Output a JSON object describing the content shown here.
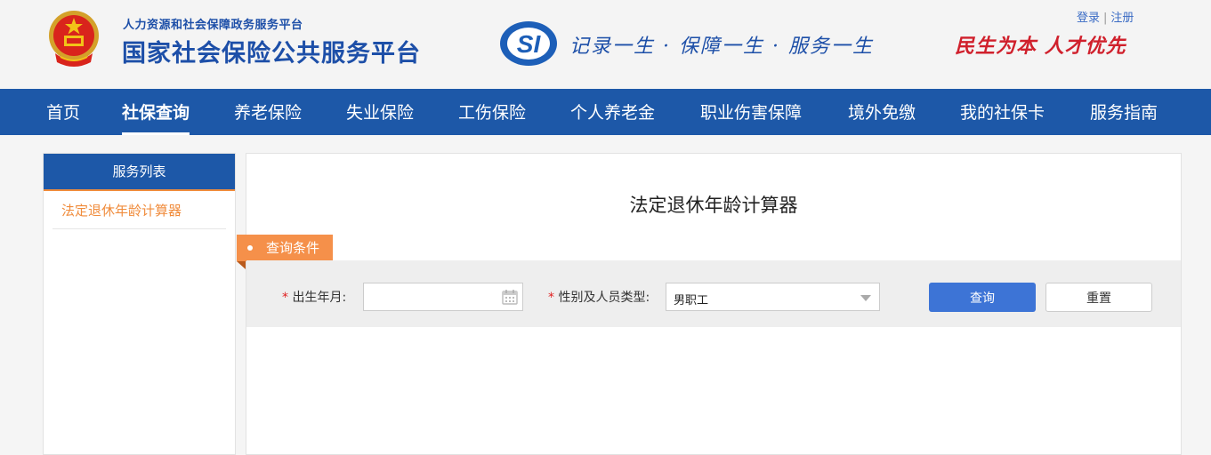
{
  "header": {
    "subtitle": "人力资源和社会保障政务服务平台",
    "title": "国家社会保险公共服务平台",
    "logo_text": "SI",
    "slogan": "记录一生 · 保障一生 · 服务一生",
    "motto": "民生为本 人才优先",
    "login": "登录",
    "separator": "|",
    "register": "注册"
  },
  "nav": {
    "items": [
      {
        "label": "首页"
      },
      {
        "label": "社保查询",
        "active": true
      },
      {
        "label": "养老保险"
      },
      {
        "label": "失业保险"
      },
      {
        "label": "工伤保险"
      },
      {
        "label": "个人养老金"
      },
      {
        "label": "职业伤害保障"
      },
      {
        "label": "境外免缴"
      },
      {
        "label": "我的社保卡"
      },
      {
        "label": "服务指南"
      }
    ]
  },
  "sidebar": {
    "heading": "服务列表",
    "items": [
      {
        "label": "法定退休年龄计算器"
      }
    ]
  },
  "main": {
    "title": "法定退休年龄计算器",
    "condition_tag": "查询条件",
    "required_mark": "*",
    "birth_label": "出生年月:",
    "birth_value": "",
    "gender_label": "性别及人员类型:",
    "gender_value": "男职工",
    "query_button": "查询",
    "reset_button": "重置"
  },
  "colors": {
    "brand_blue": "#1d58a8",
    "accent_orange": "#f08c3c",
    "motto_red": "#d0202c",
    "query_button": "#3d74d6"
  },
  "icons": [
    "national-emblem-icon",
    "si-logo-icon",
    "calendar-icon",
    "chevron-down-icon"
  ]
}
